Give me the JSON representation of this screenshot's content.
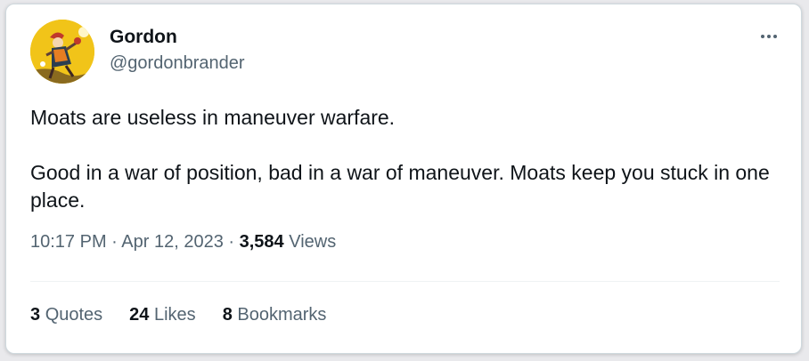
{
  "tweet": {
    "author": {
      "name": "Gordon",
      "handle": "@gordonbrander",
      "avatar_icon": "jester-tarot-avatar"
    },
    "more_icon": "more-horizontal-icon",
    "text": {
      "line1": "Moats are useless in maneuver warfare.",
      "line2": "Good in a war of position, bad in a war of maneuver. Moats keep you stuck in one place."
    },
    "meta": {
      "time": "10:17 PM",
      "separator": "·",
      "date": "Apr 12, 2023",
      "views_count": "3,584",
      "views_label": "Views"
    },
    "stats": [
      {
        "count": "3",
        "label": "Quotes"
      },
      {
        "count": "24",
        "label": "Likes"
      },
      {
        "count": "8",
        "label": "Bookmarks"
      }
    ]
  },
  "colors": {
    "text_primary": "#0f1419",
    "text_secondary": "#536471",
    "border": "#cfd9de",
    "avatar_bg": "#f1c419"
  }
}
